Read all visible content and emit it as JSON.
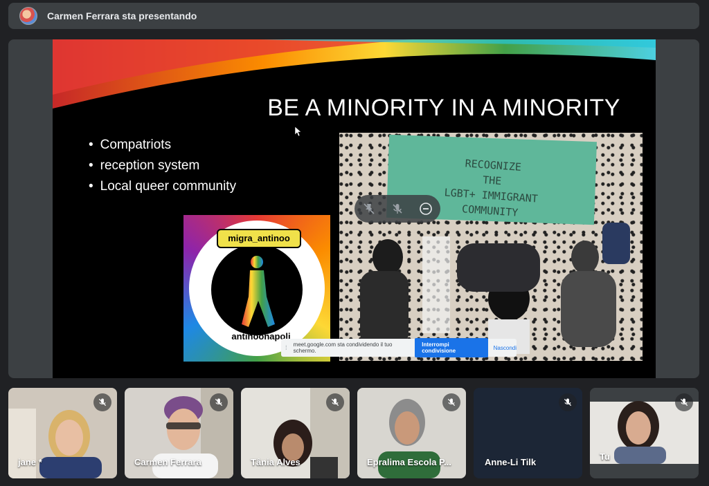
{
  "header": {
    "presenter_text": "Carmen Ferrara sta presentando",
    "avatar_icon": "presenter-avatar"
  },
  "slide": {
    "title": "BE A MINORITY IN A MINORITY",
    "bullets": [
      "Compatriots",
      "reception system",
      "Local queer community"
    ],
    "poster_lines": [
      "RECOGNIZE",
      "THE",
      "LGBT+ IMMIGRANT",
      "COMMUNITY"
    ],
    "logo_banner": "migra_antinoo",
    "logo_sub": "antinoonapoli"
  },
  "presentation_controls": {
    "icons": [
      "unpin-icon",
      "mic-off-icon",
      "remove-icon"
    ]
  },
  "share_bar": {
    "message": "meet.google.com sta condividendo il tuo schermo.",
    "stop_label": "Interrompi condivisione",
    "hide_label": "Nascondi"
  },
  "participants": [
    {
      "name": "jane *",
      "mic": "muted"
    },
    {
      "name": "Carmen Ferrara",
      "mic": "muted"
    },
    {
      "name": "Tânia Alves",
      "mic": "muted"
    },
    {
      "name": "Epralima Escola P...",
      "mic": "muted"
    },
    {
      "name": "Anne-Li Tilk",
      "mic": "muted"
    },
    {
      "name": "Tu",
      "mic": "muted"
    }
  ],
  "colors": {
    "background": "#202124",
    "surface": "#3c4043",
    "accent": "#1a73e8"
  }
}
